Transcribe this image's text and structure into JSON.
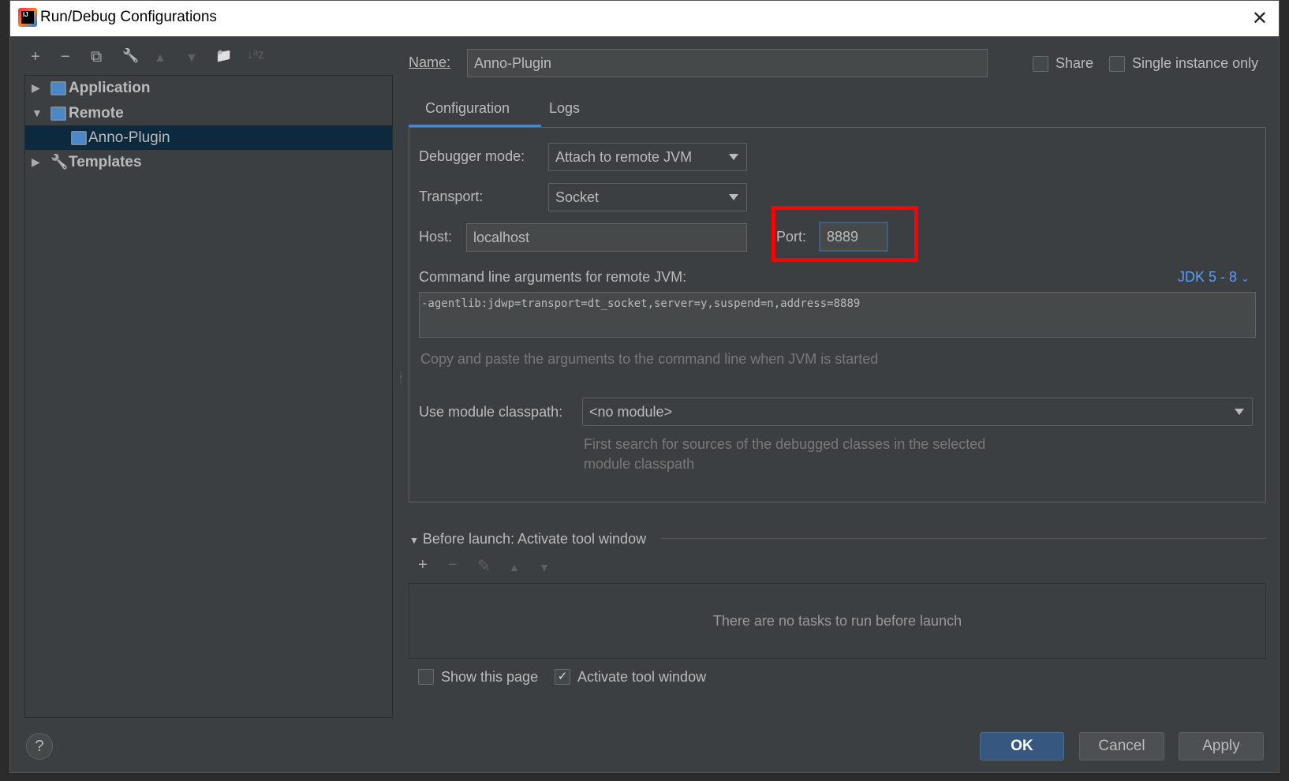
{
  "window": {
    "title": "Run/Debug Configurations",
    "logo_text": "IJ"
  },
  "toolbar": {
    "add": "+",
    "remove": "−",
    "copy": "⧉",
    "edit": "🔧",
    "up": "▲",
    "down": "▼",
    "folder": "📁",
    "sort": "↓ᵃz"
  },
  "tree": {
    "items": [
      {
        "label": "Application",
        "expanded": false,
        "bold": true
      },
      {
        "label": "Remote",
        "expanded": true,
        "bold": true
      },
      {
        "label": "Anno-Plugin",
        "selected": true
      },
      {
        "label": "Templates",
        "expanded": false,
        "bold": true
      }
    ]
  },
  "form": {
    "name_label": "Name:",
    "name_value": "Anno-Plugin",
    "share_label": "Share",
    "share_checked": false,
    "single_label": "Single instance only",
    "single_checked": false,
    "tabs": [
      {
        "label": "Configuration",
        "active": true
      },
      {
        "label": "Logs",
        "active": false
      }
    ],
    "debugger_label": "Debugger mode:",
    "debugger_value": "Attach to remote JVM",
    "transport_label": "Transport:",
    "transport_value": "Socket",
    "host_label": "Host:",
    "host_value": "localhost",
    "port_label": "Port:",
    "port_value": "8889",
    "cmd_label": "Command line arguments for remote JVM:",
    "jdk_link": "JDK 5 - 8",
    "cmd_value": "-agentlib:jdwp=transport=dt_socket,server=y,suspend=n,address=8889",
    "cmd_hint": "Copy and paste the arguments to the command line when JVM is started",
    "module_label": "Use module classpath:",
    "module_value": "<no module>",
    "module_hint1": "First search for sources of the debugged classes in the selected",
    "module_hint2": "module classpath"
  },
  "before_launch": {
    "title": "Before launch: Activate tool window",
    "empty_text": "There are no tasks to run before launch",
    "toolbar": {
      "add": "+",
      "remove": "−",
      "edit": "✎",
      "up": "▲",
      "down": "▼"
    },
    "show_page_label": "Show this page",
    "show_page_checked": false,
    "activate_label": "Activate tool window",
    "activate_checked": true
  },
  "buttons": {
    "help": "?",
    "ok": "OK",
    "cancel": "Cancel",
    "apply": "Apply"
  },
  "colors": {
    "accent": "#365880",
    "link": "#589df6",
    "highlight_box": "#ff0000",
    "selection": "#0d293e"
  }
}
